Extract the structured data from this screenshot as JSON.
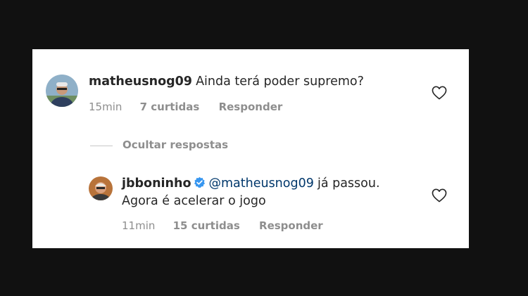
{
  "comment": {
    "username": "matheusnog09",
    "text": "Ainda terá poder supremo?",
    "time": "15min",
    "likes": "7 curtidas",
    "reply_label": "Responder"
  },
  "hide_replies_label": "Ocultar respostas",
  "reply": {
    "username": "jbboninho",
    "mention": "@matheusnog09",
    "text_line1_rest": "já passou.",
    "text_line2": "Agora é acelerar o jogo",
    "time": "11min",
    "likes": "15 curtidas",
    "reply_label": "Responder"
  },
  "colors": {
    "background": "#111111",
    "card": "#ffffff",
    "text": "#262626",
    "secondary": "#8e8e8e",
    "mention": "#00376b",
    "verified": "#3897f0"
  },
  "icons": {
    "like": "heart-outline-icon",
    "verified": "verified-badge-icon"
  }
}
